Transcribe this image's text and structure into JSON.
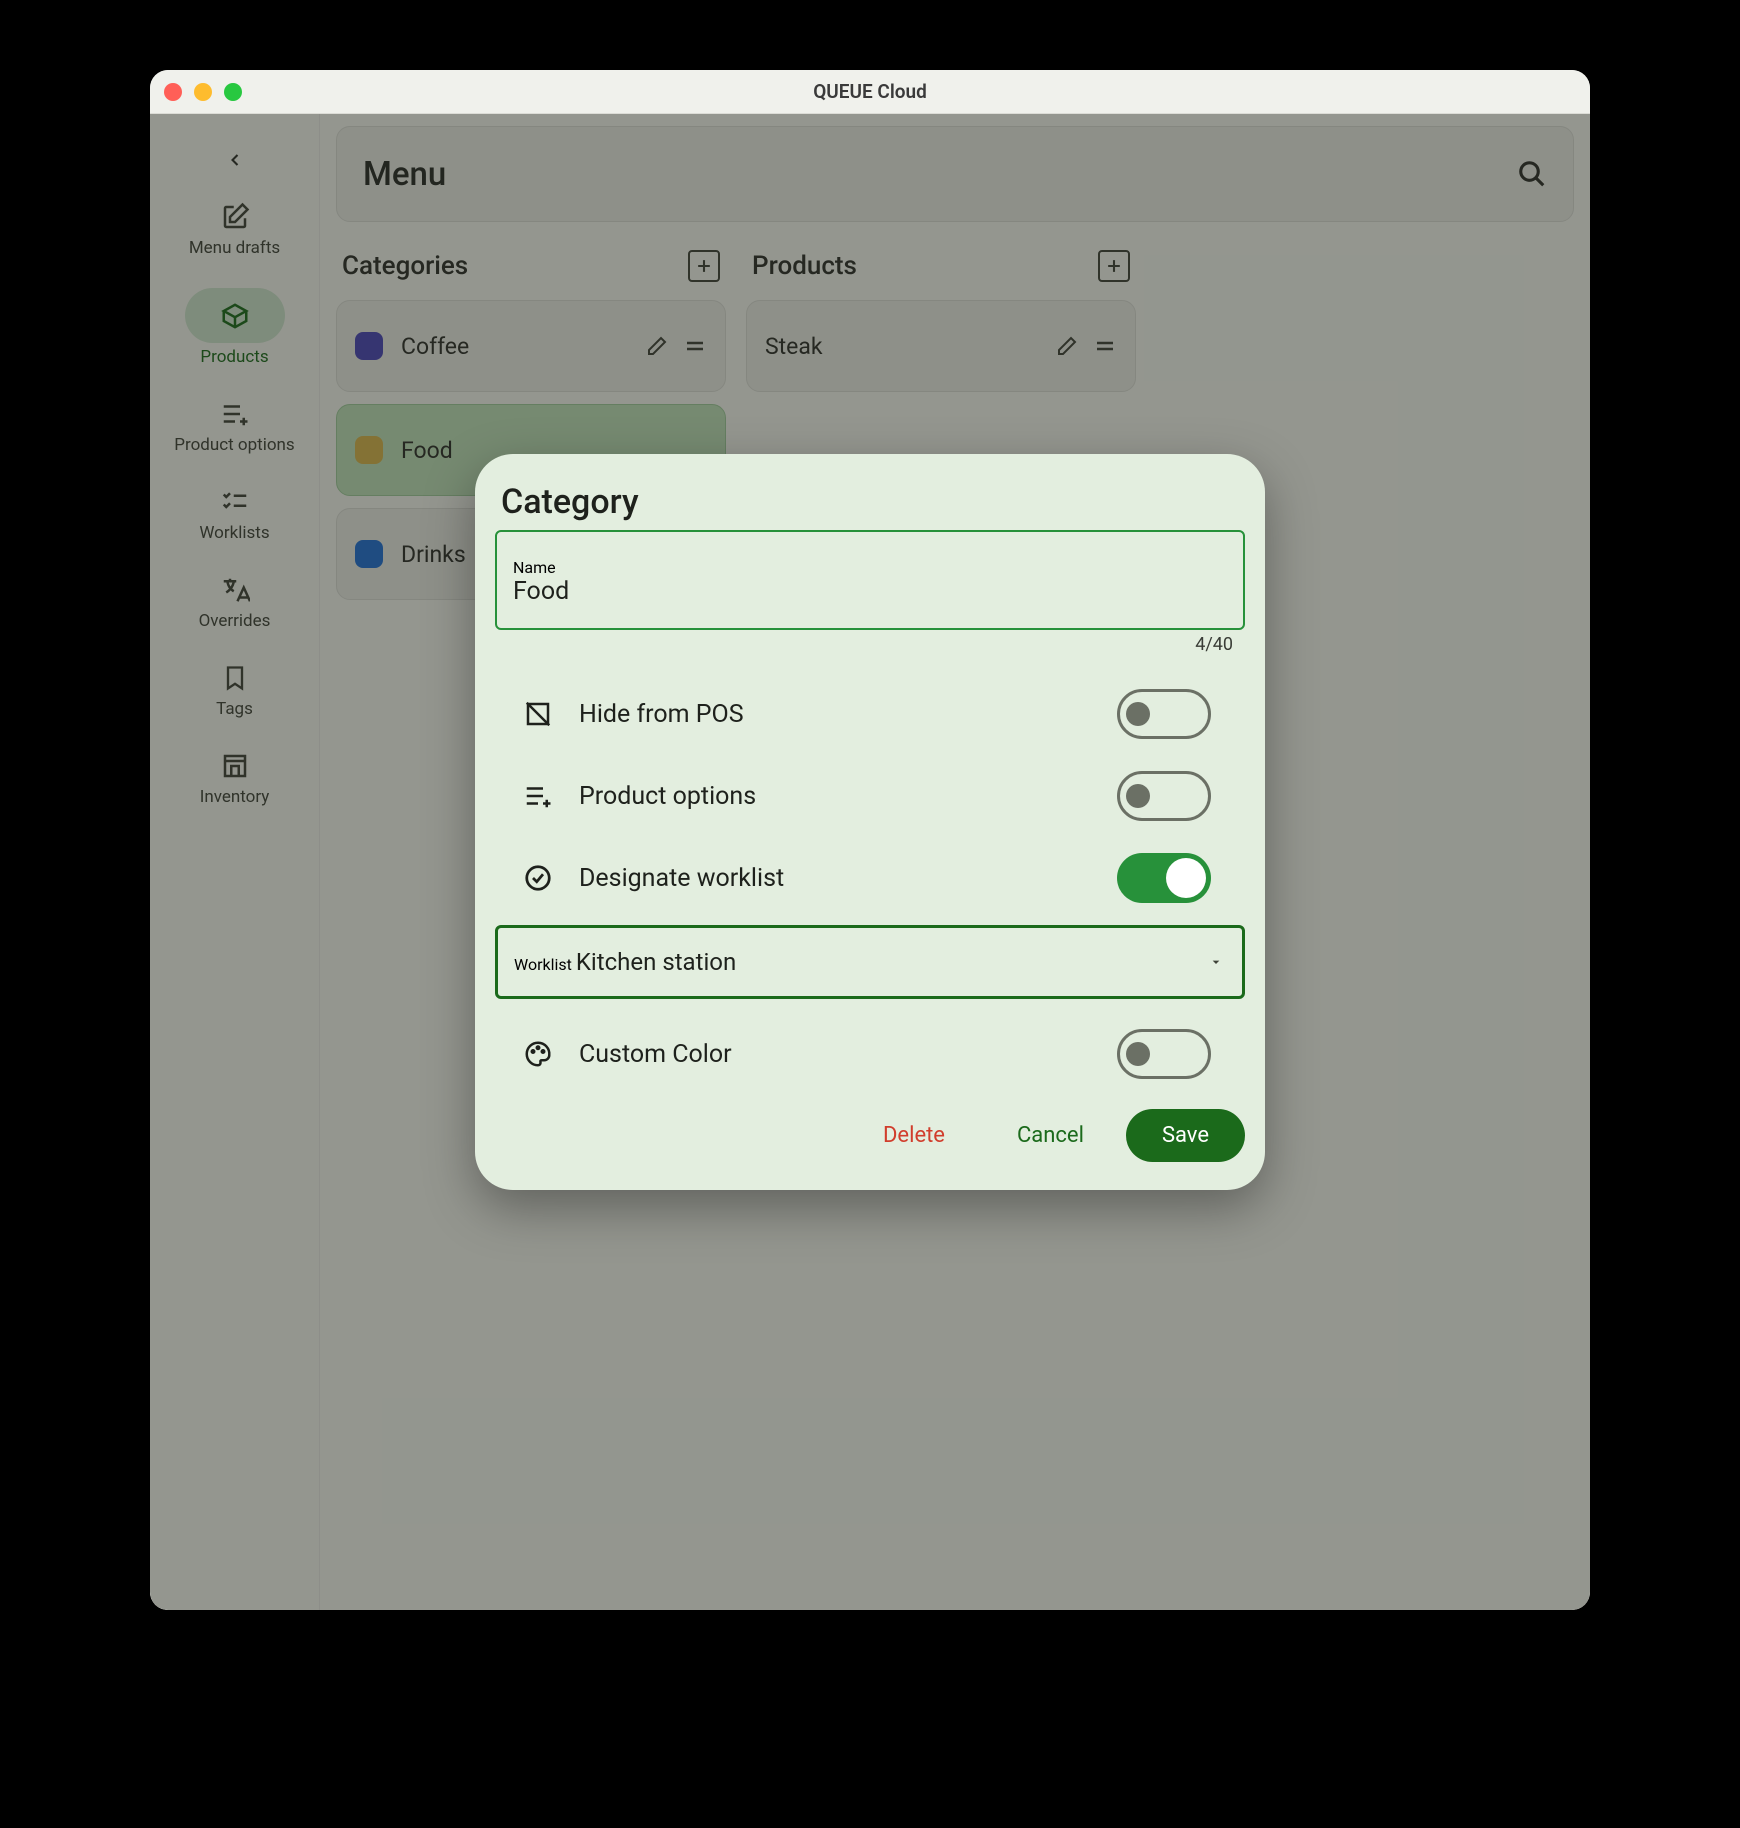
{
  "window": {
    "title": "QUEUE Cloud"
  },
  "sidebar": {
    "items": [
      {
        "label": "Menu drafts"
      },
      {
        "label": "Products"
      },
      {
        "label": "Product options"
      },
      {
        "label": "Worklists"
      },
      {
        "label": "Overrides"
      },
      {
        "label": "Tags"
      },
      {
        "label": "Inventory"
      }
    ]
  },
  "header": {
    "title": "Menu"
  },
  "columns": {
    "categories": {
      "heading": "Categories",
      "items": [
        {
          "name": "Coffee",
          "color": "#4a46b8"
        },
        {
          "name": "Food",
          "color": "#d8b44c"
        },
        {
          "name": "Drinks",
          "color": "#1f6fd6"
        }
      ]
    },
    "products": {
      "heading": "Products",
      "items": [
        {
          "name": "Steak"
        }
      ]
    }
  },
  "modal": {
    "title": "Category",
    "name_label": "Name",
    "name_value": "Food",
    "name_counter": "4/40",
    "options": {
      "hide_pos": {
        "label": "Hide from POS",
        "on": false
      },
      "product_options": {
        "label": "Product options",
        "on": false
      },
      "designate_worklist": {
        "label": "Designate worklist",
        "on": true
      },
      "custom_color": {
        "label": "Custom Color",
        "on": false
      }
    },
    "worklist": {
      "label": "Worklist",
      "value": "Kitchen station"
    },
    "buttons": {
      "delete": "Delete",
      "cancel": "Cancel",
      "save": "Save"
    }
  }
}
